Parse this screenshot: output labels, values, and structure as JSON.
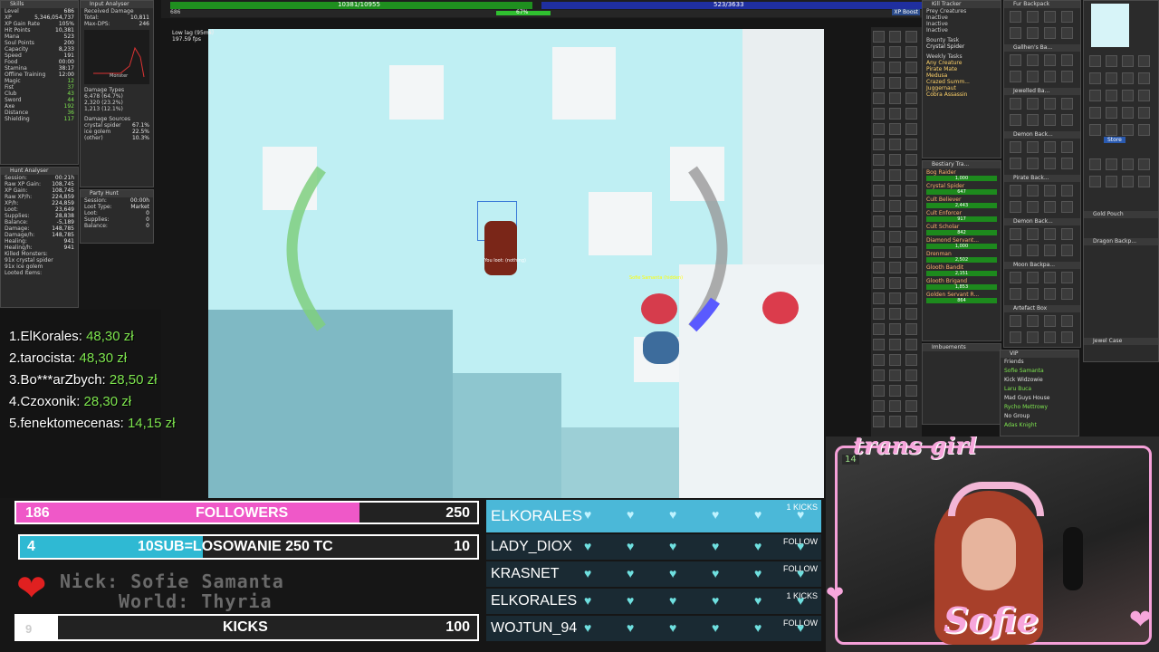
{
  "skills": {
    "title": "Skills",
    "rows": [
      {
        "label": "Level",
        "value": "686"
      },
      {
        "label": "XP",
        "value": "5,346,054,737"
      },
      {
        "label": "XP Gain Rate",
        "value": "105%"
      },
      {
        "label": "Hit Points",
        "value": "10,381"
      },
      {
        "label": "Mana",
        "value": "523"
      },
      {
        "label": "Soul Points",
        "value": "200"
      },
      {
        "label": "Capacity",
        "value": "8,233"
      },
      {
        "label": "Speed",
        "value": "191"
      },
      {
        "label": "Food",
        "value": "00:00"
      },
      {
        "label": "Stamina",
        "value": "38:17"
      },
      {
        "label": "Offline Training",
        "value": "12:00"
      },
      {
        "label": "Magic",
        "value": "12"
      },
      {
        "label": "Fist",
        "value": "37"
      },
      {
        "label": "Club",
        "value": "43"
      },
      {
        "label": "Sword",
        "value": "44"
      },
      {
        "label": "Axe",
        "value": "192"
      },
      {
        "label": "Distance",
        "value": "36"
      },
      {
        "label": "Shielding",
        "value": "117"
      }
    ],
    "xp_boost": "XP Boost"
  },
  "hunt": {
    "title": "Hunt Analyser",
    "rows": [
      {
        "label": "Session:",
        "value": "00:21h"
      },
      {
        "label": "Raw XP Gain:",
        "value": "108,745"
      },
      {
        "label": "XP Gain:",
        "value": "108,745"
      },
      {
        "label": "Raw XP/h:",
        "value": "224,859"
      },
      {
        "label": "XP/h:",
        "value": "224,859"
      },
      {
        "label": "Loot:",
        "value": "23,649"
      },
      {
        "label": "Supplies:",
        "value": "28,838"
      },
      {
        "label": "Balance:",
        "value": "-5,189"
      },
      {
        "label": "Damage:",
        "value": "148,785"
      },
      {
        "label": "Damage/h:",
        "value": "148,785"
      },
      {
        "label": "Healing:",
        "value": "941"
      },
      {
        "label": "Healing/h:",
        "value": "941"
      }
    ],
    "killed_title": "Killed Monsters:",
    "killed": [
      "91x crystal spider",
      "91x ice golem"
    ],
    "looted": "Looted Items:"
  },
  "input": {
    "title": "Input Analyser",
    "received": "Received Damage",
    "total_label": "Total:",
    "total": "10,811",
    "maxdps_label": "Max-DPS:",
    "maxdps": "246",
    "chart_legend": "Monster",
    "dmg_types_title": "Damage Types",
    "dmg_types": [
      "6,478 (64.7%)",
      "2,320 (23.2%)",
      "1,213 (12.1%)"
    ],
    "dmg_sources_title": "Damage Sources",
    "dmg_sources": [
      {
        "label": "crystal spider",
        "value": "67.1%"
      },
      {
        "label": "ice golem",
        "value": "22.5%"
      },
      {
        "label": "(other)",
        "value": "10.3%"
      }
    ]
  },
  "party": {
    "title": "Party Hunt",
    "rows": [
      {
        "label": "Session:",
        "value": "00:00h"
      },
      {
        "label": "Loot Type:",
        "value": "Market"
      },
      {
        "label": "Loot:",
        "value": "0"
      },
      {
        "label": "Supplies:",
        "value": "0"
      },
      {
        "label": "Balance:",
        "value": "0"
      }
    ]
  },
  "top": {
    "hp_text": "10381/10955",
    "mana_text": "523/3633",
    "level_small": "686",
    "xp_pct": "67%",
    "xp_boost_btn": "XP Boost",
    "lag": "Low lag (95ms)",
    "fps": "197.59 fps"
  },
  "leaderboard": [
    {
      "rank": "1.",
      "name": "ElKorales:",
      "amount": "48,30 zł"
    },
    {
      "rank": "2.",
      "name": "tarocista:",
      "amount": "48,30 zł"
    },
    {
      "rank": "3.",
      "name": "Bo***arZbych:",
      "amount": "28,50 zł"
    },
    {
      "rank": "4.",
      "name": "Czoxonik:",
      "amount": "28,30 zł"
    },
    {
      "rank": "5.",
      "name": "fenektomecenas:",
      "amount": "14,15 zł"
    }
  ],
  "goals": {
    "followers": {
      "current": "186",
      "label": "FOLLOWERS",
      "target": "250",
      "fraction": 0.744,
      "color": "#ef58c8"
    },
    "subs": {
      "current": "4",
      "label": "10SUB=LOSOWANIE 250 TC",
      "target": "10",
      "fraction": 0.4,
      "color": "#2fb9d3"
    },
    "kicks": {
      "current": "9",
      "label": "KICKS",
      "target": "100",
      "fraction": 0.09,
      "color": "#ffffff"
    }
  },
  "nick_banner": {
    "line1": "Nick: Sofie Samanta",
    "line2": "World: Thyria"
  },
  "events": [
    {
      "name": "ELKORALES",
      "tag": "1 KICKS"
    },
    {
      "name": "LADY_DIOX",
      "tag": "FOLLOW"
    },
    {
      "name": "KRASNET",
      "tag": "FOLLOW"
    },
    {
      "name": "ELKORALES",
      "tag": "1 KICKS"
    },
    {
      "name": "WOJTUN_94",
      "tag": "FOLLOW"
    }
  ],
  "game": {
    "player_label": "Sofie Samanta",
    "npc_label": "Sofie Samanta (hidden)",
    "loot_text": "You loot: (nothing)"
  },
  "right_panel": {
    "kill_tracker": "Kill Tracker",
    "prey_title": "Prey Creatures",
    "prey": [
      "Inactive",
      "Inactive",
      "Inactive"
    ],
    "bounty_title": "Bounty Task",
    "bounty": "Crystal Spider",
    "weekly_title": "Weekly Tasks",
    "weekly": [
      "Any Creature",
      "Pirate Mate",
      "Medusa",
      "Crazed Summ...",
      "Juggernaut",
      "Cobra Assassin"
    ],
    "bestiary_title": "Bestiary Tra...",
    "bestiary": [
      {
        "name": "Bog Raider",
        "value": "1,000"
      },
      {
        "name": "Crystal Spider",
        "value": "647"
      },
      {
        "name": "Cult Believer",
        "value": "2,443"
      },
      {
        "name": "Cult Enforcer",
        "value": "917"
      },
      {
        "name": "Cult Scholar",
        "value": "842"
      },
      {
        "name": "Diamond Servant...",
        "value": "1,000"
      },
      {
        "name": "Drenman",
        "value": "2,502"
      },
      {
        "name": "Glooth Bandit",
        "value": "2,151"
      },
      {
        "name": "Glooth Brigand",
        "value": "1,853"
      },
      {
        "name": "Golden Servant R...",
        "value": "864"
      }
    ],
    "imbuements": "Imbuements",
    "vip_title": "VIP",
    "vip_groups": [
      {
        "label": "Friends",
        "color": "#e0e0e0"
      },
      {
        "label": "Sofie Samanta",
        "color": "#7ee54f"
      },
      {
        "label": "Kick Widzowie",
        "color": "#e0e0e0"
      },
      {
        "label": "Laru Buca",
        "color": "#7ee54f"
      },
      {
        "label": "Mad Guys House",
        "color": "#e0e0e0"
      },
      {
        "label": "Rycho Mettrowy",
        "color": "#7ee54f"
      },
      {
        "label": "No Group",
        "color": "#e0e0e0"
      },
      {
        "label": "Adas Knight",
        "color": "#7ee54f"
      }
    ],
    "backpacks": [
      "Fur Backpack",
      "Gallhen's Ba...",
      "Jewelled Ba...",
      "Demon Back...",
      "Pirate Back...",
      "Demon Back...",
      "Moon Backpa...",
      "Artefact Box"
    ],
    "backpacks2": [
      "Gold Pouch",
      "Dragon Backp...",
      "Jewel Case"
    ],
    "store": "Store"
  },
  "webcam": {
    "title": "trans girl",
    "name": "Sofie",
    "badge": "14"
  }
}
